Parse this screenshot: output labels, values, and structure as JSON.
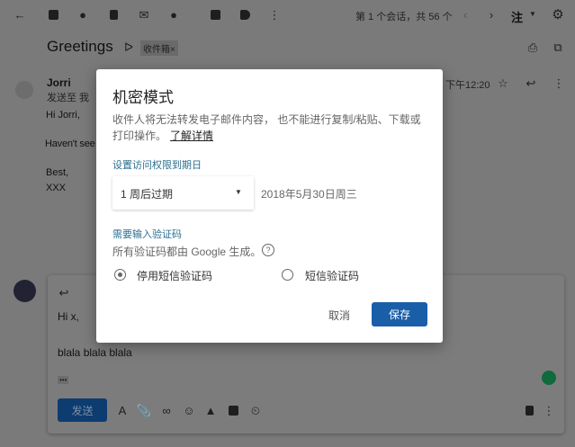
{
  "toolbar": {
    "icons": [
      "back-icon",
      "archive-icon",
      "report-spam-icon",
      "delete-icon",
      "mark-unread-icon",
      "snooze-icon",
      "move-to-icon",
      "label-icon",
      "more-icon"
    ],
    "pager": "第 1 个会话，共 56 个",
    "input_tool": "注",
    "settings": "gear-icon"
  },
  "thread": {
    "subject": "Greetings",
    "label_chip": "收件箱",
    "label_chip_close": "×"
  },
  "message": {
    "sender": "Jorri",
    "to": "发送至 我",
    "time": "下午12:20",
    "body": [
      "Hi Jorri,",
      "Haven't see",
      "Best,",
      "XXX"
    ]
  },
  "compose": {
    "body": [
      "Hi x,",
      "blala blala blala"
    ],
    "ellipsis": "•••",
    "send": "发送"
  },
  "modal": {
    "title": "机密模式",
    "description": "收件人将无法转发电子邮件内容， 也不能进行复制/粘贴、下载或打印操作。",
    "learn_more": "了解详情",
    "expiry_heading": "设置访问权限到期日",
    "expiry_select": "1 周后过期",
    "expiry_date": "2018年5月30日周三",
    "passcode_heading": "需要输入验证码",
    "passcode_desc": "所有验证码都由 Google 生成。",
    "radio_options": [
      {
        "label": "停用短信验证码",
        "selected": true
      },
      {
        "label": "短信验证码",
        "selected": false
      }
    ],
    "cancel": "取消",
    "save": "保存"
  },
  "colors": {
    "accent": "#1a5ea8",
    "heading": "#2b6f8f",
    "overlay": "#7b7a7b"
  }
}
